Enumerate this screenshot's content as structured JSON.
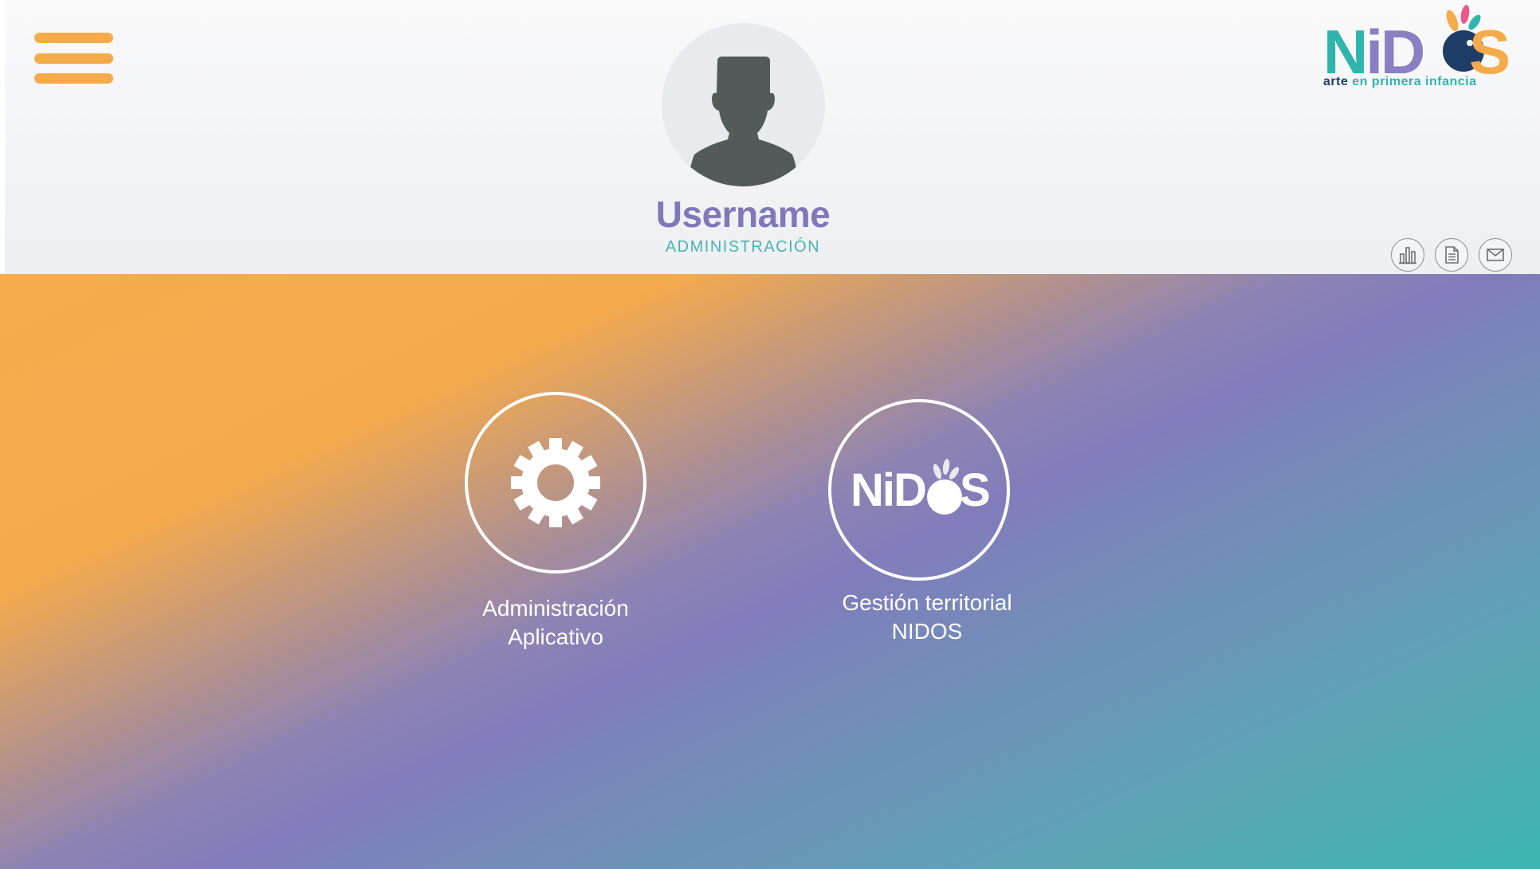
{
  "header": {
    "menu_icon": "hamburger-menu-icon",
    "logo": {
      "word": "NIDOS",
      "sub_part1": "arte ",
      "sub_part2": "en primera infancia"
    },
    "profile": {
      "username": "Username",
      "role": "ADMINISTRACIÓN",
      "avatar_icon": "user-silhouette-icon"
    },
    "toolbar": [
      {
        "icon": "bar-chart-icon"
      },
      {
        "icon": "document-icon"
      },
      {
        "icon": "envelope-icon"
      }
    ]
  },
  "modules": [
    {
      "line1": "Administración",
      "line2": "Aplicativo",
      "icon": "gear-icon"
    },
    {
      "line1": "Gestión territorial",
      "line2": "NIDOS",
      "icon": "nidos-logo-icon",
      "logo_word": "NIDOS"
    }
  ],
  "colors": {
    "accent_orange": "#f6ab4b",
    "username_purple": "#8277b9",
    "role_teal": "#49b4b0",
    "logo_teal": "#2fb5ad",
    "logo_purple": "#8a7fc0",
    "logo_navy": "#1e3d66"
  }
}
